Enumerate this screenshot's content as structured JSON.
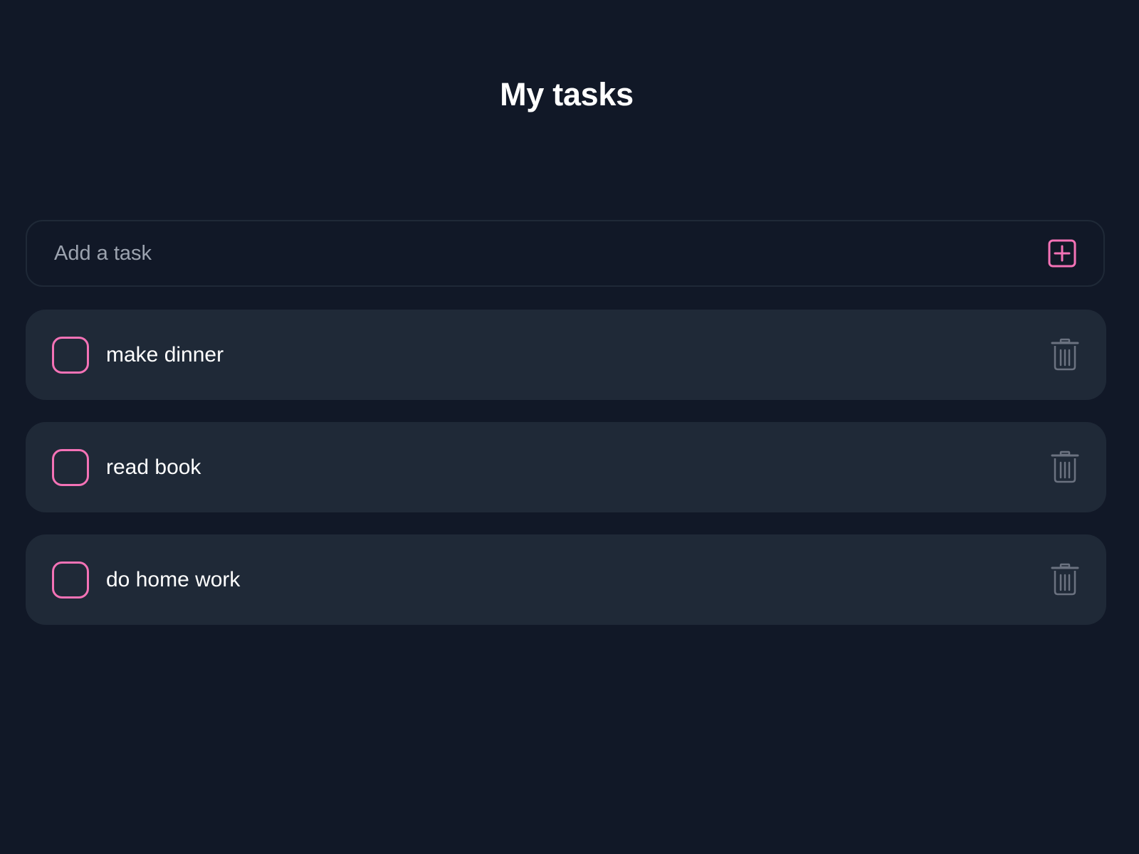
{
  "header": {
    "title": "My tasks"
  },
  "add_form": {
    "placeholder": "Add a task",
    "value": "",
    "add_icon": "plus-square-icon"
  },
  "tasks": [
    {
      "label": "make dinner",
      "completed": false
    },
    {
      "label": "read book",
      "completed": false
    },
    {
      "label": "do home work",
      "completed": false
    }
  ],
  "icons": {
    "checkbox": "checkbox-icon",
    "delete": "trash-icon"
  },
  "colors": {
    "background": "#111827",
    "card": "#1f2937",
    "accent": "#f472b6",
    "muted_icon": "#6b7280",
    "text": "#ffffff",
    "placeholder": "#9ca3af"
  }
}
